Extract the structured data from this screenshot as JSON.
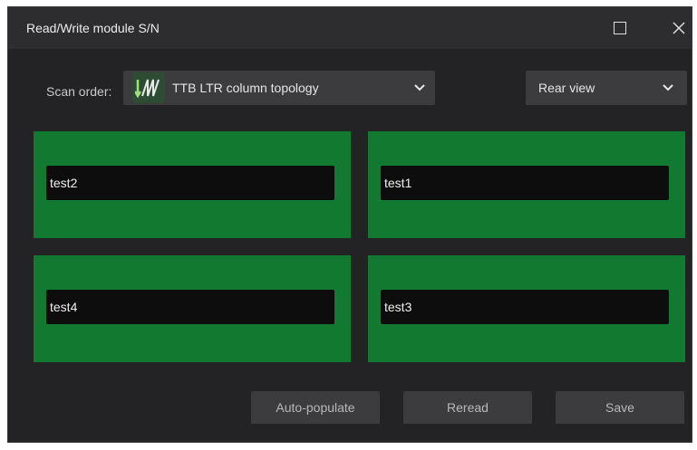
{
  "window": {
    "title": "Read/Write module S/N",
    "maximize_icon": "maximize-icon",
    "close_icon": "close-icon"
  },
  "toolbar": {
    "scan_order_label": "Scan order:",
    "scan_order_value": "TTB LTR column topology",
    "scan_order_icon": "column-topology-icon",
    "view_value": "Rear view"
  },
  "modules": [
    {
      "serial": "test2"
    },
    {
      "serial": "test1"
    },
    {
      "serial": "test4"
    },
    {
      "serial": "test3"
    }
  ],
  "buttons": {
    "auto_populate": "Auto-populate",
    "reread": "Reread",
    "save": "Save"
  },
  "colors": {
    "module_bg": "#127a30",
    "window_bg": "#232325",
    "titlebar_bg": "#2d2d2f",
    "control_bg": "#3c3c3e",
    "input_bg": "#0d0d0d"
  }
}
